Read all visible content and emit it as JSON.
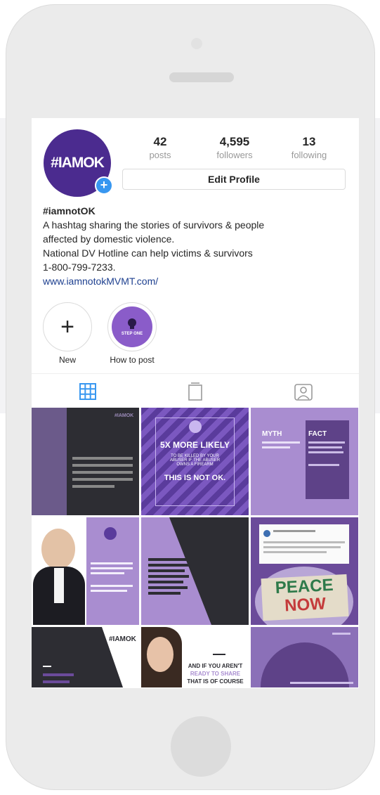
{
  "profile": {
    "avatar_text": "#IAMOK",
    "stats": [
      {
        "value": "42",
        "label": "posts"
      },
      {
        "value": "4,595",
        "label": "followers"
      },
      {
        "value": "13",
        "label": "following"
      }
    ],
    "edit_label": "Edit Profile",
    "name": "#iamnotOK",
    "bio_lines": [
      "A hashtag sharing the stories of survivors & people",
      "affected by domestic violence.",
      "National DV Hotline can help victims & survivors",
      "1-800-799-7233."
    ],
    "link": "www.iamnotokMVMT.com/"
  },
  "highlights": [
    {
      "label": "New",
      "icon": "plus-icon"
    },
    {
      "label": "How to post",
      "icon": "lightbulb-icon",
      "badge": "STEP ONE"
    }
  ],
  "tabs": [
    "grid-icon",
    "igtv-icon",
    "tagged-icon"
  ],
  "posts": {
    "p1_tag": "#IAMOK",
    "p2_lines": [
      "5X MORE LIKELY",
      "TO BE KILLED BY YOUR",
      "ABUSER IF THE ABUSER",
      "OWNS A FIREARM",
      "THIS IS NOT OK."
    ],
    "p3_myth": "MYTH",
    "p3_fact": "FACT",
    "p6_sign": [
      "PEACE",
      "NOW"
    ],
    "p7_tag": "#IAMOK",
    "p8_lines": [
      "AND IF YOU AREN'T",
      "READY TO SHARE",
      "THAT IS OF COURSE"
    ]
  },
  "colors": {
    "accent": "#4b2b8f",
    "link": "#1d3f8f",
    "blue": "#3897f0",
    "purple": "#6b4b9a",
    "light_purple": "#a98dd0",
    "dark": "#2d2d33"
  }
}
